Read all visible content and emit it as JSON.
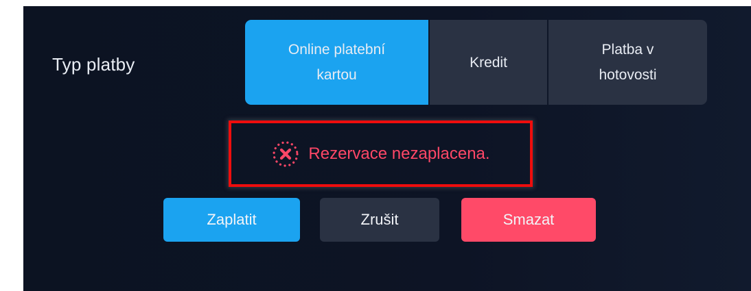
{
  "payment": {
    "label": "Typ platby",
    "options": [
      {
        "line1": "Online platební",
        "line2": "kartou",
        "selected": true
      },
      {
        "line1": "Kredit",
        "selected": false
      },
      {
        "line1": "Platba v",
        "line2": "hotovosti",
        "selected": false
      }
    ]
  },
  "alert": {
    "icon": "error-x-circle-icon",
    "message": "Rezervace nezaplacena.",
    "color": "#ff4767"
  },
  "actions": {
    "pay_label": "Zaplatit",
    "cancel_label": "Zrušit",
    "delete_label": "Smazat"
  },
  "colors": {
    "accent": "#1ba3f0",
    "danger": "#ff4a68",
    "segment_bg": "#2a3243",
    "highlight_border": "#ee0d0d"
  }
}
